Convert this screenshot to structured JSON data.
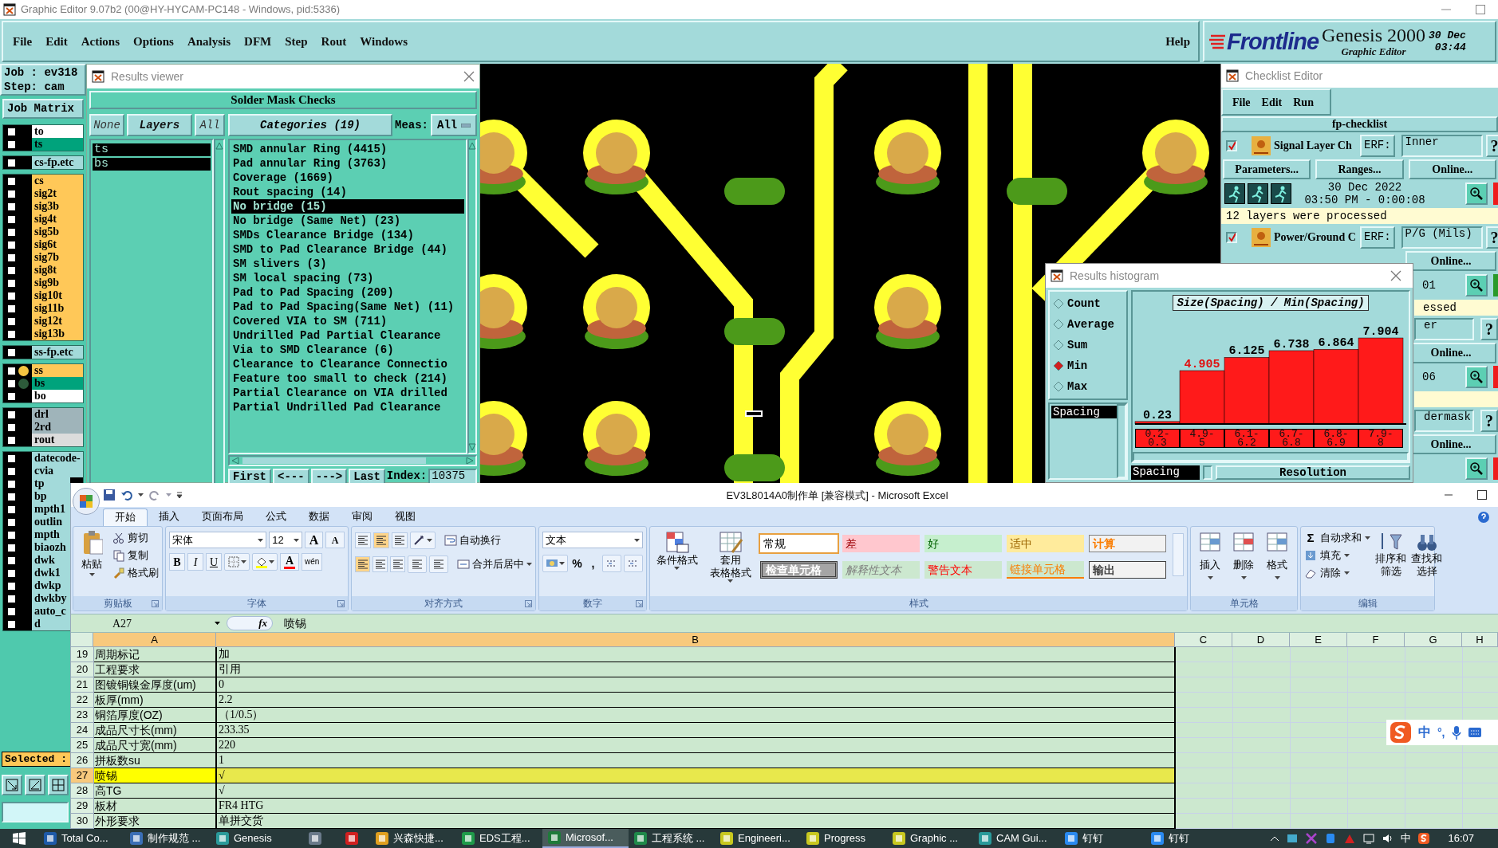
{
  "title_bar": {
    "title": "Graphic Editor 9.07b2 (00@HY-HYCAM-PC148 - Windows, pid:5336)"
  },
  "menu_bar": {
    "items": [
      "File",
      "Edit",
      "Actions",
      "Options",
      "Analysis",
      "DFM",
      "Step",
      "Rout",
      "Windows"
    ],
    "help": "Help"
  },
  "brand": {
    "logo": "Frontline",
    "product": "Genesis 2000",
    "subtitle": "Graphic Editor",
    "date": "30 Dec",
    "time": "03:44"
  },
  "job_panel": {
    "job": "Job : ev318",
    "step": "Step: cam",
    "matrix_button": "Job Matrix",
    "layer_groups": [
      {
        "layers": [
          {
            "name": "to",
            "color": "#ffffff",
            "checked": false
          },
          {
            "name": "ts",
            "color": "#00a37c",
            "checked": false
          }
        ]
      },
      {
        "layers": [
          {
            "name": "cs-fp.etc",
            "color": "#a3dada",
            "checked": false
          }
        ]
      },
      {
        "layers": [
          {
            "name": "cs",
            "color": "#ffc858",
            "checked": false
          },
          {
            "name": "sig2t",
            "color": "#ffc858",
            "checked": false
          },
          {
            "name": "sig3b",
            "color": "#ffc858",
            "checked": false
          },
          {
            "name": "sig4t",
            "color": "#ffc858",
            "checked": false
          },
          {
            "name": "sig5b",
            "color": "#ffc858",
            "checked": false
          },
          {
            "name": "sig6t",
            "color": "#ffc858",
            "checked": false
          },
          {
            "name": "sig7b",
            "color": "#ffc858",
            "checked": false
          },
          {
            "name": "sig8t",
            "color": "#ffc858",
            "checked": false
          },
          {
            "name": "sig9b",
            "color": "#ffc858",
            "checked": false
          },
          {
            "name": "sig10t",
            "color": "#ffc858",
            "checked": false
          },
          {
            "name": "sig11b",
            "color": "#ffc858",
            "checked": false
          },
          {
            "name": "sig12t",
            "color": "#ffc858",
            "checked": false
          },
          {
            "name": "sig13b",
            "color": "#ffc858",
            "checked": false
          }
        ]
      },
      {
        "layers": [
          {
            "name": "ss-fp.etc",
            "color": "#a3dada",
            "checked": false
          }
        ]
      },
      {
        "layers": [
          {
            "name": "ss",
            "color": "#ffc858",
            "checked": false,
            "displayed": true
          },
          {
            "name": "bs",
            "color": "#00a37c",
            "checked": false,
            "displayed": false
          },
          {
            "name": "bo",
            "color": "#ffffff",
            "checked": false
          }
        ]
      },
      {
        "layers": [
          {
            "name": "drl",
            "color": "#9fb4ba",
            "checked": false
          },
          {
            "name": "2rd",
            "color": "#9fb4ba",
            "checked": false
          },
          {
            "name": "rout",
            "color": "#dcdcdc",
            "checked": false
          }
        ]
      },
      {
        "layers": [
          {
            "name": "datecode-",
            "color": "#a3dada",
            "checked": false
          },
          {
            "name": "cvia",
            "color": "#a3dada",
            "checked": false
          },
          {
            "name": "tp",
            "color": "#a3dada",
            "checked": false
          },
          {
            "name": "bp",
            "color": "#a3dada",
            "checked": false
          },
          {
            "name": "mpth1",
            "color": "#a3dada",
            "checked": false
          },
          {
            "name": "outlin",
            "color": "#a3dada",
            "checked": false
          },
          {
            "name": "mpth",
            "color": "#a3dada",
            "checked": false
          },
          {
            "name": "biaozh",
            "color": "#a3dada",
            "checked": false
          },
          {
            "name": "dwk",
            "color": "#a3dada",
            "checked": false
          },
          {
            "name": "dwk1",
            "color": "#a3dada",
            "checked": false
          },
          {
            "name": "dwkp",
            "color": "#a3dada",
            "checked": false
          },
          {
            "name": "dwkby",
            "color": "#a3dada",
            "checked": false
          },
          {
            "name": "auto_c",
            "color": "#a3dada",
            "checked": false
          },
          {
            "name": "d",
            "color": "#a3dada",
            "checked": false
          }
        ]
      }
    ],
    "selected_label": "Selected :"
  },
  "results_viewer": {
    "title": "Results viewer",
    "header": "Solder Mask Checks",
    "layer_buttons": [
      "None",
      "Layers",
      "All"
    ],
    "layers": [
      {
        "name": "ts",
        "selected": true
      },
      {
        "name": "bs",
        "selected": true
      }
    ],
    "categories_button": "Categories (19)",
    "meas_label": "Meas:",
    "meas_value": "All",
    "categories": [
      {
        "label": "SMD annular Ring (4415)",
        "selected": false
      },
      {
        "label": "Pad annular Ring (3763)",
        "selected": false
      },
      {
        "label": "Coverage (1669)",
        "selected": false
      },
      {
        "label": "Rout spacing (14)",
        "selected": false
      },
      {
        "label": "No bridge (15)",
        "selected": true
      },
      {
        "label": "No bridge (Same Net) (23)",
        "selected": false
      },
      {
        "label": "SMDs Clearance Bridge (134)",
        "selected": false
      },
      {
        "label": "SMD to Pad Clearance Bridge (44)",
        "selected": false
      },
      {
        "label": "SM slivers (3)",
        "selected": false
      },
      {
        "label": "SM local spacing (73)",
        "selected": false
      },
      {
        "label": "Pad to Pad Spacing (209)",
        "selected": false
      },
      {
        "label": "Pad to Pad Spacing(Same Net) (11)",
        "selected": false
      },
      {
        "label": "Covered VIA to SM (711)",
        "selected": false
      },
      {
        "label": "Undrilled Pad Partial Clearance",
        "selected": false
      },
      {
        "label": "Via to SMD Clearance (6)",
        "selected": false
      },
      {
        "label": "Clearance to Clearance Connectio",
        "selected": false
      },
      {
        "label": "Feature too small to check (214)",
        "selected": false
      },
      {
        "label": "Partial Clearance on VIA drilled",
        "selected": false
      },
      {
        "label": "Partial Undrilled Pad Clearance",
        "selected": false
      }
    ],
    "nav_buttons": [
      "First",
      "<---",
      "--->",
      "Last"
    ],
    "index_label": "Index:",
    "index_value": "10375"
  },
  "checklist_editor": {
    "title": "Checklist Editor",
    "menu": [
      "File",
      "Edit",
      "Run"
    ],
    "name": "fp-checklist",
    "rows": [
      {
        "kind": "action",
        "label": "Signal Layer Ch",
        "checked": true,
        "erf": "ERF:",
        "value": "Inner",
        "help": "?"
      },
      {
        "kind": "buttons",
        "buttons": [
          "Parameters...",
          "Ranges...",
          "Online..."
        ]
      },
      {
        "kind": "run",
        "date": "30 Dec 2022",
        "time": "03:50 PM - 0:00:08",
        "color": "#ee1c1c"
      },
      {
        "kind": "status",
        "text": "12 layers were processed"
      },
      {
        "kind": "action",
        "label": "Power/Ground C",
        "checked": true,
        "erf": "ERF:",
        "value": "P/G (Mils)",
        "help": "?"
      },
      {
        "kind": "buttons",
        "buttons": [
          "Online..."
        ]
      },
      {
        "kind": "run_tail",
        "time": "01",
        "color": "#2a9a2a"
      },
      {
        "kind": "status_tail",
        "text": "essed"
      },
      {
        "kind": "action_tail",
        "value": "er",
        "help": "?"
      },
      {
        "kind": "buttons",
        "buttons": [
          "Online..."
        ]
      },
      {
        "kind": "run_tail",
        "time": "06",
        "color": "#ee1c1c"
      },
      {
        "kind": "status_tail"
      },
      {
        "kind": "action_tail",
        "value": "dermask",
        "help": "?"
      },
      {
        "kind": "buttons",
        "buttons": [
          "Online..."
        ]
      },
      {
        "kind": "run_tail",
        "color": "#ee1c1c"
      }
    ]
  },
  "histogram": {
    "title": "Results histogram",
    "modes": [
      {
        "label": "Count",
        "selected": false
      },
      {
        "label": "Average",
        "selected": false
      },
      {
        "label": "Sum",
        "selected": false
      },
      {
        "label": "Min",
        "selected": true
      },
      {
        "label": "Max",
        "selected": false
      }
    ],
    "list": [
      {
        "label": "Spacing",
        "selected": true
      }
    ],
    "chart_data": {
      "type": "bar",
      "title": "Size(Spacing) / Min(Spacing)",
      "categories": [
        "0.2-0.3",
        "4.9-5",
        "6.1-6.2",
        "6.7-6.8",
        "6.8-6.9",
        "7.9-8"
      ],
      "series": [
        {
          "color": "#ff1a1a",
          "values": [
            0.23,
            4.905,
            6.125,
            6.738,
            6.864,
            7.904
          ]
        }
      ],
      "data_labels": true
    },
    "field": "Spacing",
    "column_header": "Resolution"
  },
  "excel": {
    "title": "EV3L8014A0制作单 [兼容模式] - Microsoft Excel",
    "tabs": [
      {
        "label": "开始",
        "selected": true
      },
      {
        "label": "插入",
        "selected": false
      },
      {
        "label": "页面布局",
        "selected": false
      },
      {
        "label": "公式",
        "selected": false
      },
      {
        "label": "数据",
        "selected": false
      },
      {
        "label": "审阅",
        "selected": false
      },
      {
        "label": "视图",
        "selected": false
      }
    ],
    "groups": [
      {
        "kind": "clipboard",
        "label": "剪贴板",
        "paste": "粘贴",
        "items": [
          "剪切",
          "复制",
          "格式刷"
        ]
      },
      {
        "kind": "font",
        "label": "字体",
        "font": "宋体",
        "size": "12",
        "size_buttons": [
          "A",
          "A"
        ],
        "style_buttons": [
          "B",
          "I",
          "U"
        ],
        "font_color": "A",
        "phonetic": "wén"
      },
      {
        "kind": "alignment",
        "label": "对齐方式",
        "vertical_align": [
          {
            "selected": false
          },
          {
            "selected": true
          },
          {
            "selected": false
          }
        ],
        "horizontal_align": [
          {
            "selected": true
          },
          {
            "selected": false
          },
          {
            "selected": false
          }
        ],
        "items": [
          "自动换行",
          "合并后居中"
        ]
      },
      {
        "kind": "number",
        "label": "数字",
        "format": "文本",
        "symbols": [
          "%",
          ","
        ]
      },
      {
        "kind": "styles",
        "label": "样式",
        "buttons": [
          [
            "条件格式"
          ],
          [
            "套用",
            "表格格式"
          ]
        ],
        "styles": [
          {
            "kind": "normal",
            "label": "常规",
            "selected": true
          },
          {
            "kind": "bad",
            "label": "差",
            "selected": false
          },
          {
            "kind": "good",
            "label": "好",
            "selected": false
          },
          {
            "kind": "neutral",
            "label": "适中",
            "selected": false
          },
          {
            "kind": "calc",
            "label": "计算",
            "selected": false
          },
          {
            "kind": "check",
            "label": "检查单元格",
            "selected": false
          },
          {
            "kind": "explanatory",
            "label": "解释性文本",
            "selected": false
          },
          {
            "kind": "warning",
            "label": "警告文本",
            "selected": false
          },
          {
            "kind": "linked",
            "label": "链接单元格",
            "selected": false
          },
          {
            "kind": "output",
            "label": "输出",
            "selected": false
          }
        ]
      },
      {
        "kind": "cells",
        "label": "单元格",
        "buttons": [
          "插入",
          "删除",
          "格式"
        ]
      },
      {
        "kind": "editing",
        "label": "编辑",
        "sum_symbol": "Σ",
        "items": [
          "自动求和",
          "填充",
          "清除"
        ],
        "buttons": [
          [
            "排序和",
            "筛选"
          ],
          [
            "查找和",
            "选择"
          ]
        ]
      }
    ],
    "name_box": "A27",
    "function_label": "fx",
    "formula": "喷锡",
    "columns": [
      {
        "label": "A",
        "selected": true
      },
      {
        "label": "B",
        "selected": true
      },
      {
        "label": "C",
        "selected": false
      },
      {
        "label": "D",
        "selected": false
      },
      {
        "label": "E",
        "selected": false
      },
      {
        "label": "F",
        "selected": false
      },
      {
        "label": "G",
        "selected": false
      },
      {
        "label": "H",
        "selected": false
      }
    ],
    "rows": [
      {
        "number": "19",
        "a": "周期标记",
        "b": "加",
        "selected": false
      },
      {
        "number": "20",
        "a": "工程要求",
        "b": "引用",
        "selected": false
      },
      {
        "number": "21",
        "a": "图镀铜镍金厚度(um)",
        "b": "0",
        "selected": false
      },
      {
        "number": "22",
        "a": "板厚(mm)",
        "b": "2.2",
        "selected": false
      },
      {
        "number": "23",
        "a": "铜箔厚度(OZ)",
        "b": "（1/0.5）",
        "selected": false
      },
      {
        "number": "24",
        "a": "成品尺寸长(mm)",
        "b": "233.35",
        "selected": false
      },
      {
        "number": "25",
        "a": "成品尺寸宽(mm)",
        "b": "220",
        "selected": false
      },
      {
        "number": "26",
        "a": "拼板数su",
        "b": "1",
        "selected": false
      },
      {
        "number": "27",
        "a": "喷锡",
        "b": "√",
        "selected": true
      },
      {
        "number": "28",
        "a": "高TG",
        "b": "√",
        "selected": false
      },
      {
        "number": "29",
        "a": "板材",
        "b": "FR4 HTG",
        "selected": false
      },
      {
        "number": "30",
        "a": "外形要求",
        "b": "单拼交货",
        "selected": false
      }
    ]
  },
  "ime_bar": {
    "mode": "中",
    "punctuation": "°,"
  },
  "taskbar": {
    "tasks": [
      {
        "label": "Total Co...",
        "color": "#1e5aa8",
        "selected": false
      },
      {
        "label": "制作规范 ...",
        "color": "#3b6fb6",
        "selected": false
      },
      {
        "label": "Genesis",
        "color": "#2a9a9a",
        "selected": false
      },
      {
        "color": "#6a7a8a",
        "selected": false
      },
      {
        "color": "#d02020",
        "selected": false
      },
      {
        "label": "兴森快捷...",
        "color": "#e0a020",
        "selected": false
      },
      {
        "label": "EDS工程...",
        "color": "#1f9a4a",
        "selected": false
      },
      {
        "label": "Microsof...",
        "color": "#1f7a3a",
        "selected": true
      },
      {
        "label": "工程系统 ...",
        "color": "#1f8a4a",
        "selected": false
      },
      {
        "label": "Engineeri...",
        "color": "#c8c820",
        "selected": false
      },
      {
        "label": "Progress",
        "color": "#c8c820",
        "selected": false
      },
      {
        "label": "Graphic ...",
        "color": "#c8c820",
        "selected": false
      },
      {
        "label": "CAM Gui...",
        "color": "#2a9a9a",
        "selected": false
      },
      {
        "label": "钉钉",
        "color": "#2a8af0",
        "selected": false
      },
      {
        "label": "钉钉",
        "color": "#2a8af0",
        "selected": false
      }
    ],
    "ime": "中",
    "time": "16:07"
  }
}
